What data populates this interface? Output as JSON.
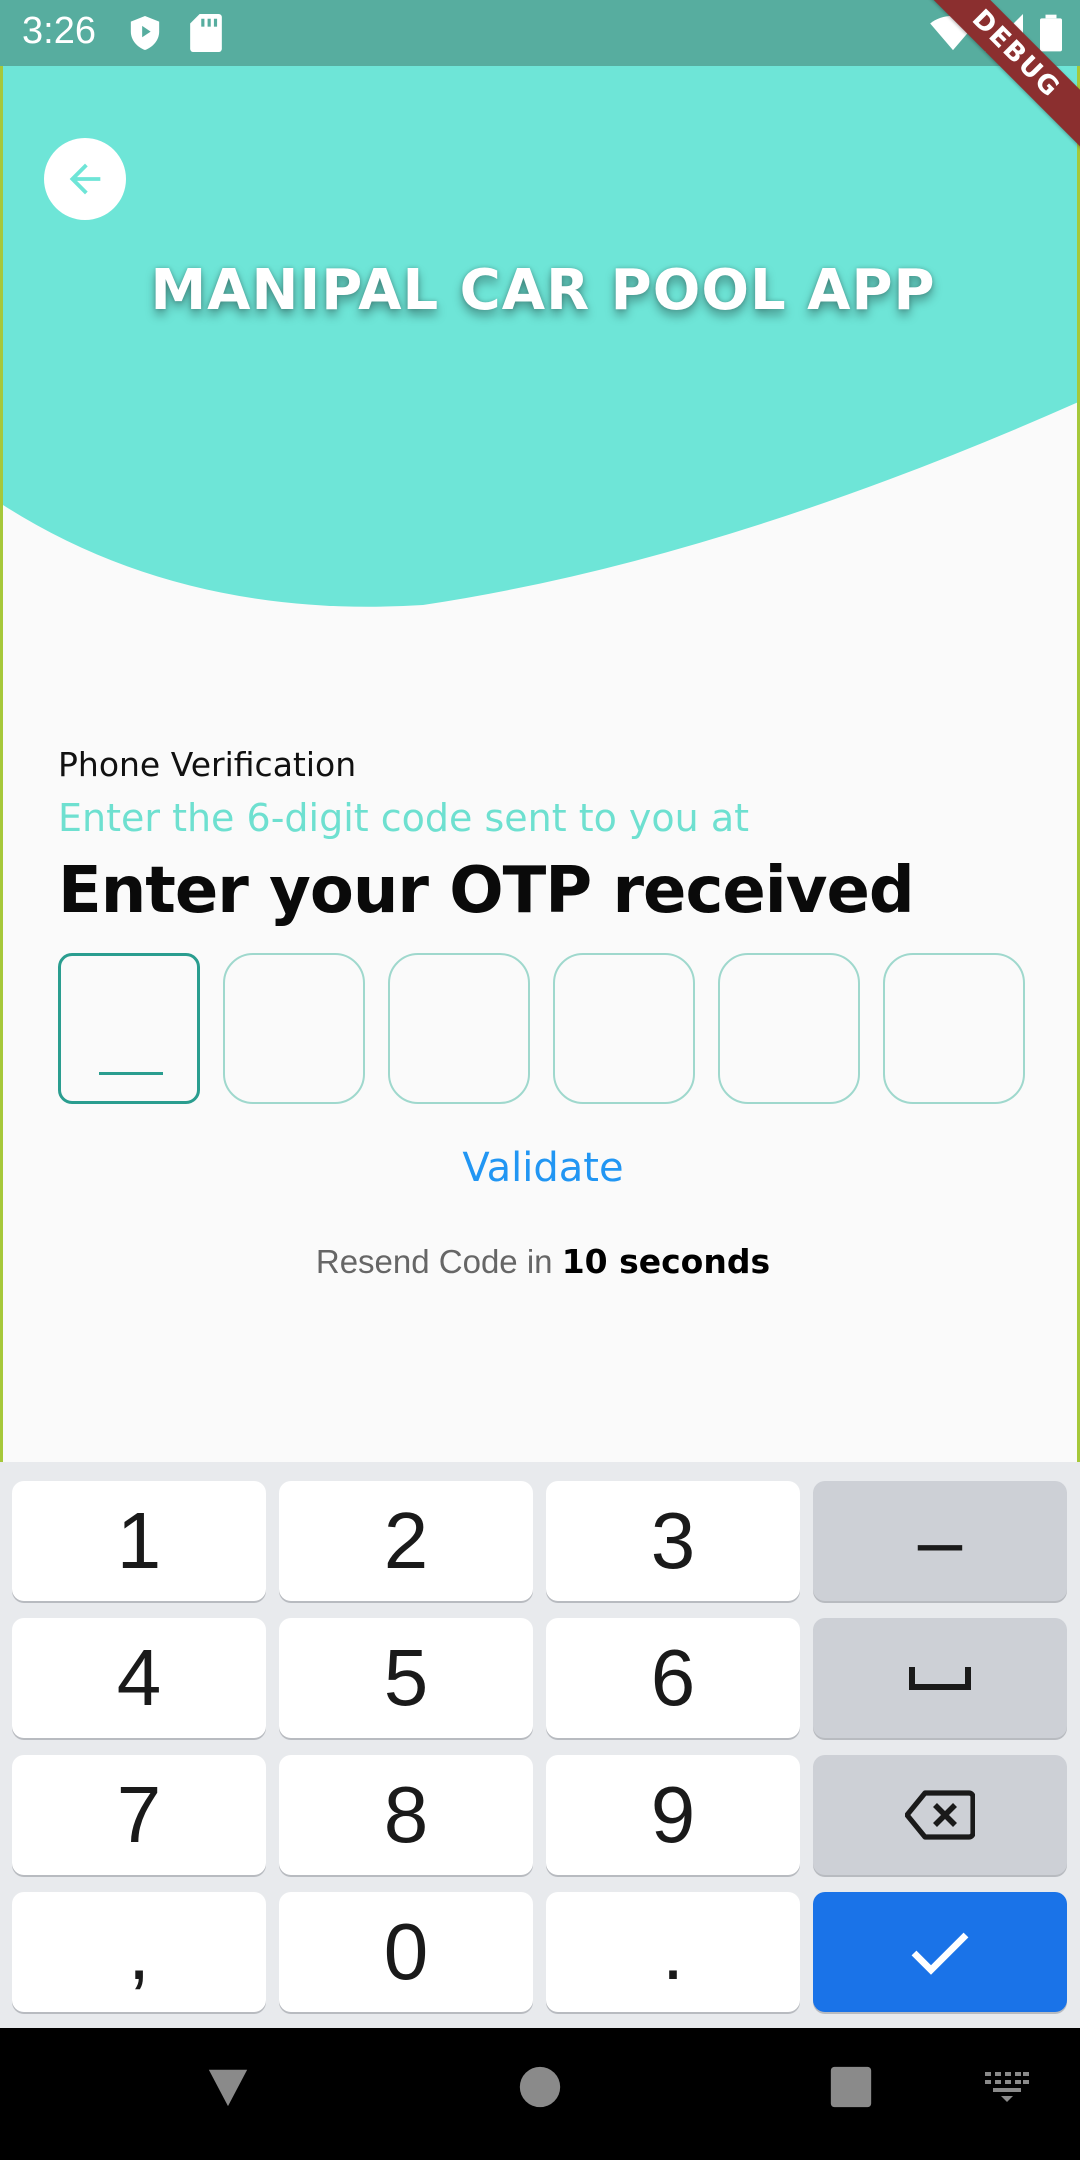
{
  "status_bar": {
    "time": "3:26",
    "icons": [
      "shield-icon",
      "sd-card-icon",
      "wifi-icon",
      "signal-icon",
      "battery-icon"
    ]
  },
  "debug_banner": "DEBUG",
  "header": {
    "title": "MANIPAL CAR POOL APP",
    "back_icon": "arrow-left-icon"
  },
  "verification": {
    "label": "Phone Verification",
    "subtitle": "Enter the 6-digit code sent to you at",
    "heading": "Enter your OTP received",
    "otp_length": 6,
    "otp_values": [
      "",
      "",
      "",
      "",
      "",
      ""
    ]
  },
  "validate_label": "Validate",
  "resend": {
    "prefix": "Resend Code in ",
    "countdown": "10 seconds"
  },
  "keyboard": {
    "rows": [
      [
        "1",
        "2",
        "3",
        "–"
      ],
      [
        "4",
        "5",
        "6",
        "space"
      ],
      [
        "7",
        "8",
        "9",
        "backspace"
      ],
      [
        ",",
        "0",
        ".",
        "enter"
      ]
    ],
    "labels": {
      "k1": "1",
      "k2": "2",
      "k3": "3",
      "dash": "–",
      "k4": "4",
      "k5": "5",
      "k6": "6",
      "k7": "7",
      "k8": "8",
      "k9": "9",
      "comma": ",",
      "k0": "0",
      "period": "."
    }
  },
  "nav_bar": [
    "back-icon",
    "home-icon",
    "recents-icon",
    "keyboard-icon"
  ],
  "colors": {
    "header": "#6ee5d7",
    "status_bar": "#57ad9f",
    "accent_link": "#2196f3",
    "enter_key": "#1a73e8"
  }
}
